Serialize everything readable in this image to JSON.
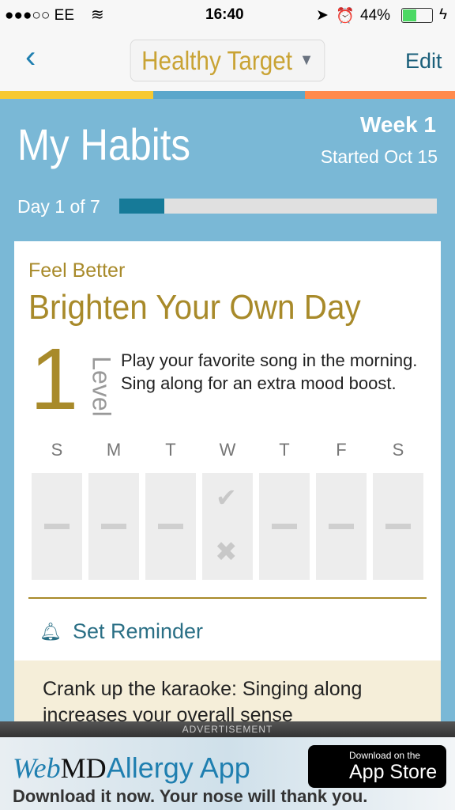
{
  "status_bar": {
    "carrier": "●●●○○ EE",
    "time": "16:40",
    "battery": "44%"
  },
  "nav": {
    "title": "Healthy Target",
    "edit": "Edit"
  },
  "stripe_colors": [
    "#f7c930",
    "#5ba7cb",
    "#ff8a4c"
  ],
  "header": {
    "title": "My Habits",
    "week": "Week 1",
    "started": "Started Oct 15",
    "day": "Day 1 of 7",
    "progress": 0.143
  },
  "habit": {
    "category": "Feel Better",
    "title": "Brighten Your Own Day",
    "level_number": "1",
    "level_label": "Level",
    "description": "Play your favorite song in the morning. Sing along for an extra mood boost.",
    "days": [
      {
        "letter": "S",
        "state": "none"
      },
      {
        "letter": "M",
        "state": "none"
      },
      {
        "letter": "T",
        "state": "none"
      },
      {
        "letter": "W",
        "state": "today"
      },
      {
        "letter": "T",
        "state": "none"
      },
      {
        "letter": "F",
        "state": "none"
      },
      {
        "letter": "S",
        "state": "none"
      }
    ],
    "reminder": "Set Reminder",
    "tip": "Crank up the karaoke: Singing along increases your overall sense"
  },
  "ad": {
    "label": "ADVERTISEMENT",
    "brand_web": "Web",
    "brand_md": "MD",
    "product": "Allergy App",
    "tagline": "Download it now. Your nose will thank you.",
    "store_small": "Download on the",
    "store_big": "App Store"
  }
}
